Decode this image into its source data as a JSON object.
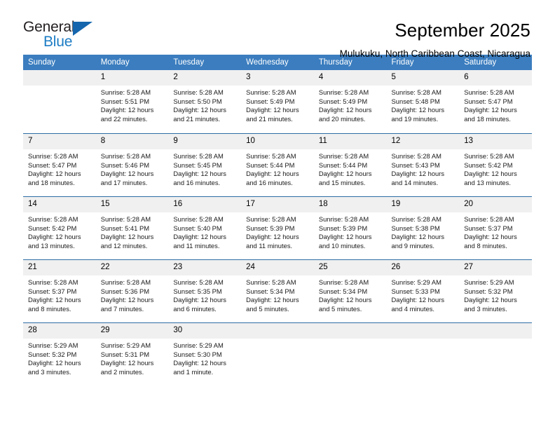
{
  "brand": {
    "name_part1": "General",
    "name_part2": "Blue",
    "accent_color": "#1c7cc4",
    "triangle_color": "#1566ad"
  },
  "header": {
    "title": "September 2025",
    "location": "Mulukuku, North Caribbean Coast, Nicaragua"
  },
  "calendar": {
    "header_bg": "#3b7dbf",
    "daynum_bg": "#f0f0f0",
    "row_divider_color": "#2e6da4",
    "weekdays": [
      "Sunday",
      "Monday",
      "Tuesday",
      "Wednesday",
      "Thursday",
      "Friday",
      "Saturday"
    ],
    "weeks": [
      [
        {
          "day": "",
          "lines": []
        },
        {
          "day": "1",
          "lines": [
            "Sunrise: 5:28 AM",
            "Sunset: 5:51 PM",
            "Daylight: 12 hours",
            "and 22 minutes."
          ]
        },
        {
          "day": "2",
          "lines": [
            "Sunrise: 5:28 AM",
            "Sunset: 5:50 PM",
            "Daylight: 12 hours",
            "and 21 minutes."
          ]
        },
        {
          "day": "3",
          "lines": [
            "Sunrise: 5:28 AM",
            "Sunset: 5:49 PM",
            "Daylight: 12 hours",
            "and 21 minutes."
          ]
        },
        {
          "day": "4",
          "lines": [
            "Sunrise: 5:28 AM",
            "Sunset: 5:49 PM",
            "Daylight: 12 hours",
            "and 20 minutes."
          ]
        },
        {
          "day": "5",
          "lines": [
            "Sunrise: 5:28 AM",
            "Sunset: 5:48 PM",
            "Daylight: 12 hours",
            "and 19 minutes."
          ]
        },
        {
          "day": "6",
          "lines": [
            "Sunrise: 5:28 AM",
            "Sunset: 5:47 PM",
            "Daylight: 12 hours",
            "and 18 minutes."
          ]
        }
      ],
      [
        {
          "day": "7",
          "lines": [
            "Sunrise: 5:28 AM",
            "Sunset: 5:47 PM",
            "Daylight: 12 hours",
            "and 18 minutes."
          ]
        },
        {
          "day": "8",
          "lines": [
            "Sunrise: 5:28 AM",
            "Sunset: 5:46 PM",
            "Daylight: 12 hours",
            "and 17 minutes."
          ]
        },
        {
          "day": "9",
          "lines": [
            "Sunrise: 5:28 AM",
            "Sunset: 5:45 PM",
            "Daylight: 12 hours",
            "and 16 minutes."
          ]
        },
        {
          "day": "10",
          "lines": [
            "Sunrise: 5:28 AM",
            "Sunset: 5:44 PM",
            "Daylight: 12 hours",
            "and 16 minutes."
          ]
        },
        {
          "day": "11",
          "lines": [
            "Sunrise: 5:28 AM",
            "Sunset: 5:44 PM",
            "Daylight: 12 hours",
            "and 15 minutes."
          ]
        },
        {
          "day": "12",
          "lines": [
            "Sunrise: 5:28 AM",
            "Sunset: 5:43 PM",
            "Daylight: 12 hours",
            "and 14 minutes."
          ]
        },
        {
          "day": "13",
          "lines": [
            "Sunrise: 5:28 AM",
            "Sunset: 5:42 PM",
            "Daylight: 12 hours",
            "and 13 minutes."
          ]
        }
      ],
      [
        {
          "day": "14",
          "lines": [
            "Sunrise: 5:28 AM",
            "Sunset: 5:42 PM",
            "Daylight: 12 hours",
            "and 13 minutes."
          ]
        },
        {
          "day": "15",
          "lines": [
            "Sunrise: 5:28 AM",
            "Sunset: 5:41 PM",
            "Daylight: 12 hours",
            "and 12 minutes."
          ]
        },
        {
          "day": "16",
          "lines": [
            "Sunrise: 5:28 AM",
            "Sunset: 5:40 PM",
            "Daylight: 12 hours",
            "and 11 minutes."
          ]
        },
        {
          "day": "17",
          "lines": [
            "Sunrise: 5:28 AM",
            "Sunset: 5:39 PM",
            "Daylight: 12 hours",
            "and 11 minutes."
          ]
        },
        {
          "day": "18",
          "lines": [
            "Sunrise: 5:28 AM",
            "Sunset: 5:39 PM",
            "Daylight: 12 hours",
            "and 10 minutes."
          ]
        },
        {
          "day": "19",
          "lines": [
            "Sunrise: 5:28 AM",
            "Sunset: 5:38 PM",
            "Daylight: 12 hours",
            "and 9 minutes."
          ]
        },
        {
          "day": "20",
          "lines": [
            "Sunrise: 5:28 AM",
            "Sunset: 5:37 PM",
            "Daylight: 12 hours",
            "and 8 minutes."
          ]
        }
      ],
      [
        {
          "day": "21",
          "lines": [
            "Sunrise: 5:28 AM",
            "Sunset: 5:37 PM",
            "Daylight: 12 hours",
            "and 8 minutes."
          ]
        },
        {
          "day": "22",
          "lines": [
            "Sunrise: 5:28 AM",
            "Sunset: 5:36 PM",
            "Daylight: 12 hours",
            "and 7 minutes."
          ]
        },
        {
          "day": "23",
          "lines": [
            "Sunrise: 5:28 AM",
            "Sunset: 5:35 PM",
            "Daylight: 12 hours",
            "and 6 minutes."
          ]
        },
        {
          "day": "24",
          "lines": [
            "Sunrise: 5:28 AM",
            "Sunset: 5:34 PM",
            "Daylight: 12 hours",
            "and 5 minutes."
          ]
        },
        {
          "day": "25",
          "lines": [
            "Sunrise: 5:28 AM",
            "Sunset: 5:34 PM",
            "Daylight: 12 hours",
            "and 5 minutes."
          ]
        },
        {
          "day": "26",
          "lines": [
            "Sunrise: 5:29 AM",
            "Sunset: 5:33 PM",
            "Daylight: 12 hours",
            "and 4 minutes."
          ]
        },
        {
          "day": "27",
          "lines": [
            "Sunrise: 5:29 AM",
            "Sunset: 5:32 PM",
            "Daylight: 12 hours",
            "and 3 minutes."
          ]
        }
      ],
      [
        {
          "day": "28",
          "lines": [
            "Sunrise: 5:29 AM",
            "Sunset: 5:32 PM",
            "Daylight: 12 hours",
            "and 3 minutes."
          ]
        },
        {
          "day": "29",
          "lines": [
            "Sunrise: 5:29 AM",
            "Sunset: 5:31 PM",
            "Daylight: 12 hours",
            "and 2 minutes."
          ]
        },
        {
          "day": "30",
          "lines": [
            "Sunrise: 5:29 AM",
            "Sunset: 5:30 PM",
            "Daylight: 12 hours",
            "and 1 minute."
          ]
        },
        {
          "day": "",
          "lines": []
        },
        {
          "day": "",
          "lines": []
        },
        {
          "day": "",
          "lines": []
        },
        {
          "day": "",
          "lines": []
        }
      ]
    ]
  }
}
